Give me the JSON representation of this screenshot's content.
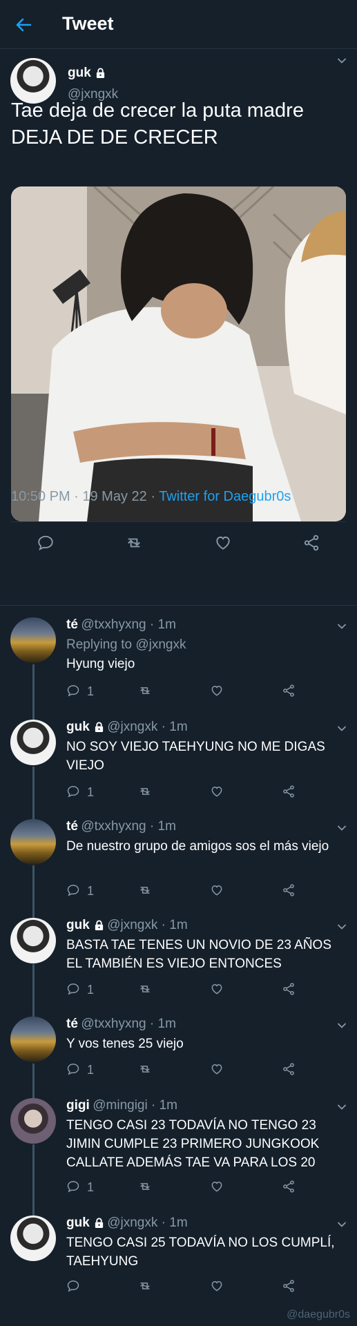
{
  "header": {
    "title": "Tweet"
  },
  "main_tweet": {
    "name": "guk",
    "handle": "@jxngxk",
    "text_line1": "Tae deja de crecer la puta madre",
    "text_line2": "DEJA DE DE CRECER",
    "time": "10:50 PM · 19 May 22 · ",
    "source": "Twitter for Daegubr0s"
  },
  "replies": [
    {
      "name": "té",
      "meta": "@txxhyxng · 1m",
      "replying_prefix": "Replying to ",
      "replying_to": "@jxngxk",
      "text": "Hyung viejo",
      "reply_count": "1"
    },
    {
      "name": "guk",
      "meta": "@jxngxk · 1m",
      "text": "NO SOY VIEJO TAEHYUNG NO ME DIGAS VIEJO",
      "reply_count": "1"
    },
    {
      "name": "té",
      "meta": "@txxhyxng · 1m",
      "text": "De nuestro grupo de amigos sos el más viejo",
      "reply_count": "1"
    },
    {
      "name": "guk",
      "meta": "@jxngxk · 1m",
      "text": "BASTA TAE TENES UN NOVIO DE 23 AÑOS EL TAMBIÉN ES VIEJO ENTONCES",
      "reply_count": "1"
    },
    {
      "name": "té",
      "meta": "@txxhyxng · 1m",
      "text": "Y vos tenes 25 viejo",
      "reply_count": "1"
    },
    {
      "name": "gigi",
      "meta": "@mingigi · 1m",
      "text": "TENGO CASI 23 TODAVÍA NO TENGO 23 JIMIN CUMPLE 23 PRIMERO JUNGKOOK CALLATE ADEMÁS TAE VA PARA LOS 20",
      "reply_count": "1"
    },
    {
      "name": "guk",
      "meta": "@jxngxk · 1m",
      "text": "TENGO CASI 25 TODAVÍA NO LOS CUMPLÍ, TAEHYUNG",
      "reply_count": ""
    }
  ],
  "watermark": "@daegubr0s",
  "colors": {
    "background": "#15202b",
    "accent": "#1da1f2",
    "muted": "#8899a6",
    "divider": "#253341"
  },
  "icons": [
    "back-arrow-icon",
    "lock-icon",
    "chevron-down-icon",
    "reply-icon",
    "retweet-icon",
    "like-icon",
    "share-icon"
  ]
}
